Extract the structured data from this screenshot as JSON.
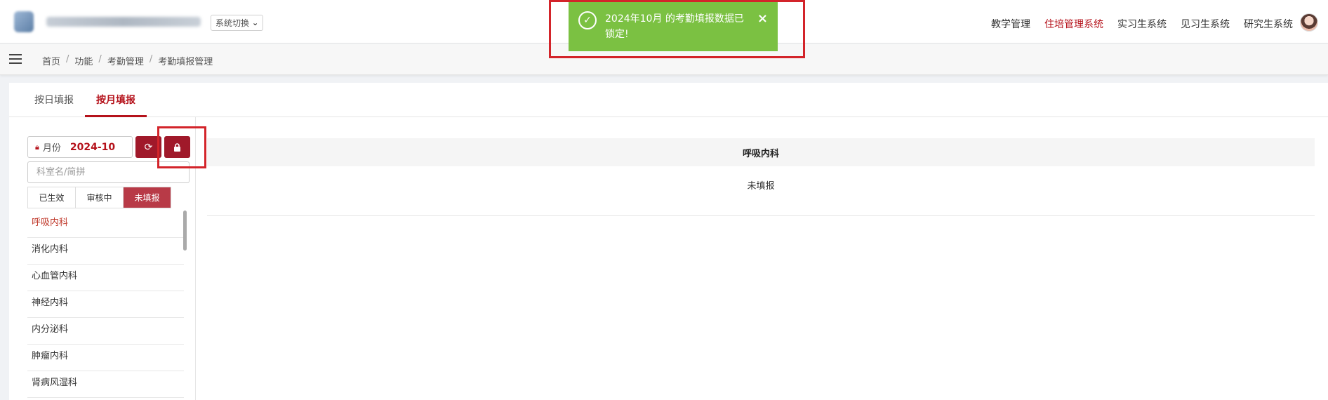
{
  "header": {
    "system_switch": "系统切换",
    "nav": [
      "教学管理",
      "住培管理系统",
      "实习生系统",
      "见习生系统",
      "研究生系统"
    ],
    "active_nav_index": 1,
    "accent_color": "#b5121b"
  },
  "breadcrumb": [
    "首页",
    "功能",
    "考勤管理",
    "考勤填报管理"
  ],
  "tabs": [
    "按日填报",
    "按月填报"
  ],
  "active_tab": 1,
  "filter": {
    "month_label": "月份",
    "month_value": "2024-10",
    "search_placeholder": "科室名/简拼",
    "status_tabs": [
      "已生效",
      "审核中",
      "未填报"
    ],
    "active_status": 2
  },
  "departments": [
    "呼吸内科",
    "消化内科",
    "心血管内科",
    "神经内科",
    "内分泌科",
    "肿瘤内科",
    "肾病风湿科"
  ],
  "table": {
    "header": "呼吸内科",
    "cell": "未填报"
  },
  "toast": {
    "message": "2024年10月 的考勤填报数据已锁定!",
    "color": "#7bc142"
  },
  "icons": {
    "refresh": "refresh-icon",
    "lock": "lock-icon",
    "close": "close-icon",
    "success": "check-circle-icon"
  }
}
